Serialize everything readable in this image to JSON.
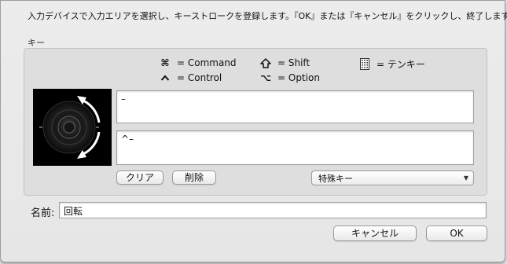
{
  "instruction": "入力デバイスで入力エリアを選択し、キーストロークを登録します。『OK』または『キャンセル』をクリックし、終了します。",
  "key_group": {
    "label": "キー",
    "legend": {
      "command": "= Command",
      "shift": "= Shift",
      "tenkey": "= テンキー",
      "control": "= Control",
      "option": "= Option"
    },
    "field_top_value": "–",
    "field_bottom_value": "^–",
    "clear_label": "クリア",
    "delete_label": "削除",
    "special_key_selected": "特殊キー"
  },
  "name_field": {
    "label": "名前:",
    "value": "回転"
  },
  "footer": {
    "cancel_label": "キャンセル",
    "ok_label": "OK"
  },
  "icons": {
    "command": "command-key-icon",
    "shift": "shift-key-icon",
    "tenkey": "numeric-keypad-icon",
    "control": "control-key-icon",
    "option": "option-key-icon",
    "device": "jog-dial-rotate-icon"
  }
}
